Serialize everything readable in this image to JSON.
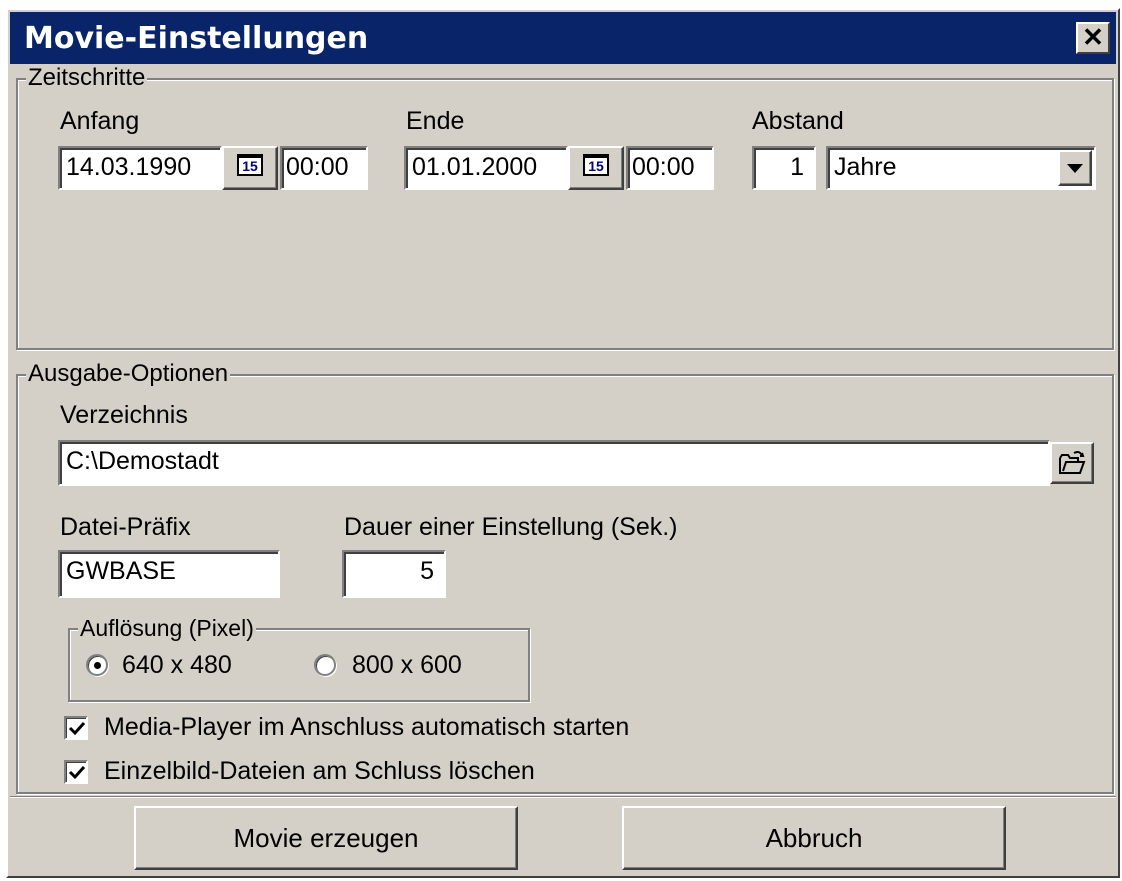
{
  "window": {
    "title": "Movie-Einstellungen",
    "close_label": "✕"
  },
  "zeitschritte": {
    "group_label": "Zeitschritte",
    "anfang": {
      "label": "Anfang",
      "date": "14.03.1990",
      "time": "00:00"
    },
    "ende": {
      "label": "Ende",
      "date": "01.01.2000",
      "time": "00:00"
    },
    "abstand": {
      "label": "Abstand",
      "value": "1",
      "unit_selected": "Jahre"
    },
    "calendar_icon_text": "15"
  },
  "ausgabe": {
    "group_label": "Ausgabe-Optionen",
    "verzeichnis": {
      "label": "Verzeichnis",
      "value": "C:\\Demostadt"
    },
    "prefix": {
      "label": "Datei-Präfix",
      "value": "GWBASE"
    },
    "dauer": {
      "label": "Dauer einer Einstellung (Sek.)",
      "value": "5"
    },
    "aufloesung": {
      "group_label": "Auflösung (Pixel)",
      "options": [
        {
          "label": "640 x 480",
          "selected": true
        },
        {
          "label": "800 x 600",
          "selected": false
        }
      ]
    },
    "checkboxes": [
      {
        "label": "Media-Player im Anschluss automatisch starten",
        "checked": true
      },
      {
        "label": "Einzelbild-Dateien am Schluss löschen",
        "checked": true
      }
    ]
  },
  "buttons": {
    "create": "Movie erzeugen",
    "cancel": "Abbruch"
  }
}
